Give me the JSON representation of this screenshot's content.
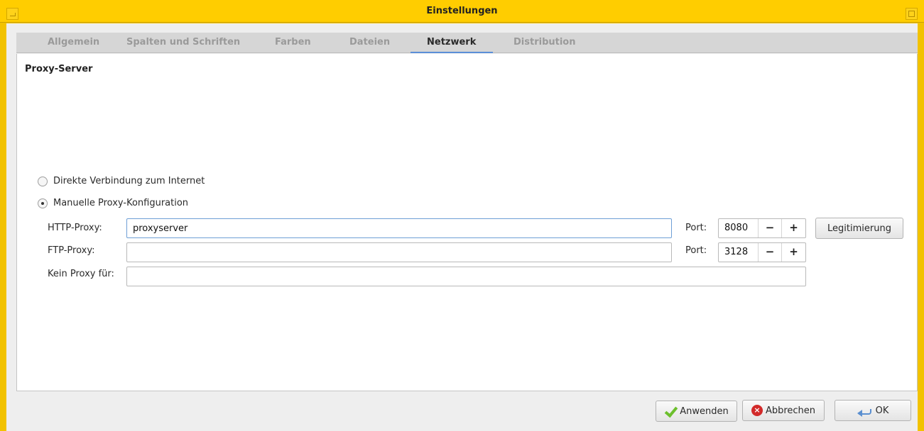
{
  "window": {
    "title": "Einstellungen"
  },
  "tabs": [
    {
      "label": "Allgemein",
      "active": false
    },
    {
      "label": "Spalten und Schriften",
      "active": false
    },
    {
      "label": "Farben",
      "active": false
    },
    {
      "label": "Dateien",
      "active": false
    },
    {
      "label": "Netzwerk",
      "active": true
    },
    {
      "label": "Distribution",
      "active": false
    }
  ],
  "proxy": {
    "section_title": "Proxy-Server",
    "options": [
      {
        "label": "Direkte Verbindung zum Internet",
        "checked": false
      },
      {
        "label": "Manuelle Proxy-Konfiguration",
        "checked": true
      }
    ],
    "http": {
      "label": "HTTP-Proxy:",
      "value": "proxyserver",
      "port_label": "Port:",
      "port": "8080"
    },
    "ftp": {
      "label": "FTP-Proxy:",
      "value": "",
      "port_label": "Port:",
      "port": "3128"
    },
    "no_proxy": {
      "label": "Kein Proxy für:",
      "value": ""
    },
    "auth_button": "Legitimierung"
  },
  "spinner": {
    "minus": "−",
    "plus": "+"
  },
  "footer": {
    "apply": "Anwenden",
    "cancel": "Abbrechen",
    "ok": "OK"
  },
  "colors": {
    "titlebar": "#ffcd00",
    "accent": "#5b8fd8"
  }
}
